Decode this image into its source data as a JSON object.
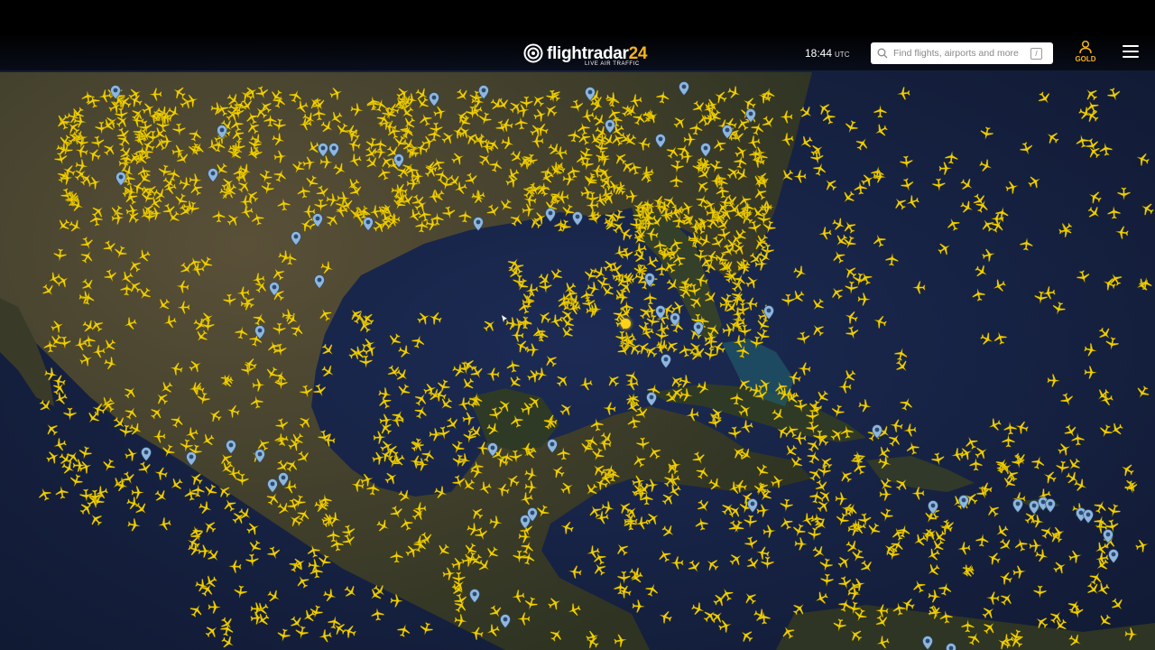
{
  "header": {
    "logo_text": "flightradar",
    "logo_number": "24",
    "logo_tagline": "LIVE AIR TRAFFIC",
    "clock_time": "18:44",
    "clock_zone": "UTC",
    "search_placeholder": "Find flights, airports and more",
    "search_shortcut": "/",
    "gold_label": "GOLD"
  },
  "colors": {
    "aircraft": "#f2d000",
    "aircraft_selected": "#ffd21a",
    "airport_pin": "#8fb6dc",
    "accent": "#f5b21f",
    "ocean": "#16203a",
    "land": "#3a3a2a"
  },
  "icons": [
    "flightradar-logo-icon",
    "search-icon",
    "user-icon",
    "hamburger-menu-icon",
    "aircraft-icon",
    "airport-pin-icon",
    "cursor-icon"
  ]
}
